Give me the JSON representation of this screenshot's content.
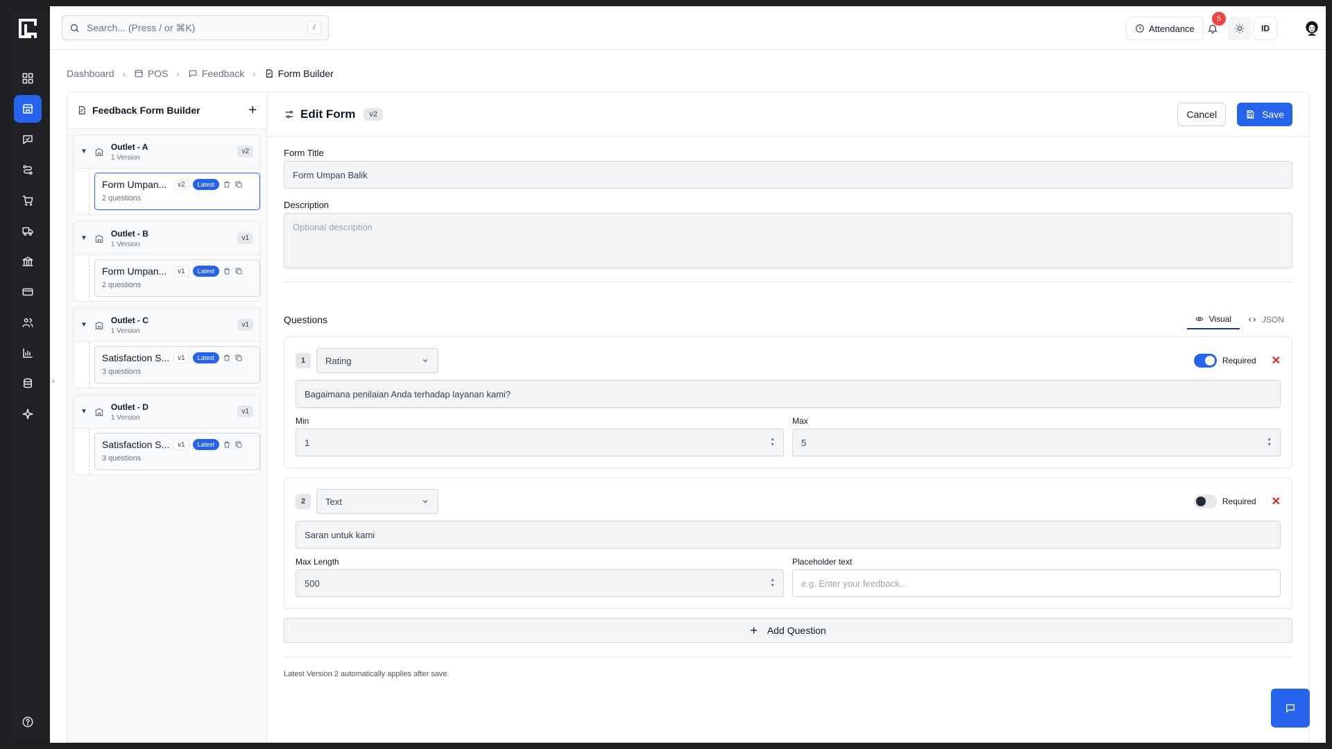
{
  "search": {
    "placeholder": "Search... (Press / or ⌘K)",
    "shortcut": "/"
  },
  "topbar": {
    "attendance_label": "Attendance",
    "notification_count": "5",
    "language": "ID"
  },
  "rail": {
    "items": [
      "dashboard-icon",
      "store-icon",
      "feedback-icon",
      "route-icon",
      "cart-icon",
      "delivery-icon",
      "bank-icon",
      "card-icon",
      "users-icon",
      "chart-icon",
      "database-icon",
      "sparkle-icon",
      "help-icon"
    ],
    "active_index": 1,
    "accent": "#2563eb"
  },
  "breadcrumb": {
    "items": [
      "Dashboard",
      "POS",
      "Feedback",
      "Form Builder"
    ]
  },
  "builder": {
    "title": "Feedback Form Builder",
    "groups": [
      {
        "name": "Outlet - A",
        "sub": "1 Version",
        "version": "v2",
        "card": {
          "name": "Form Umpan...",
          "tag": "v2",
          "latest": "Latest",
          "questions": "2 questions",
          "active": true
        }
      },
      {
        "name": "Outlet - B",
        "sub": "1 Version",
        "version": "v1",
        "card": {
          "name": "Form Umpan...",
          "tag": "v1",
          "latest": "Latest",
          "questions": "2 questions",
          "active": false
        }
      },
      {
        "name": "Outlet - C",
        "sub": "1 Version",
        "version": "v1",
        "card": {
          "name": "Satisfaction S...",
          "tag": "v1",
          "latest": "Latest",
          "questions": "3 questions",
          "active": false
        }
      },
      {
        "name": "Outlet - D",
        "sub": "1 Version",
        "version": "v1",
        "card": {
          "name": "Satisfaction S...",
          "tag": "v1",
          "latest": "Latest",
          "questions": "3 questions",
          "active": false
        }
      }
    ]
  },
  "editor": {
    "title": "Edit Form",
    "version": "v2",
    "cancel_label": "Cancel",
    "save_label": "Save",
    "form_title_label": "Form Title",
    "form_title_value": "Form Umpan Balik",
    "description_label": "Description",
    "description_placeholder": "Optional description",
    "questions_label": "Questions",
    "tabs": [
      "Visual",
      "JSON"
    ],
    "active_tab": "Visual",
    "questions": [
      {
        "number": "1",
        "type": "Rating",
        "required_label": "Required",
        "required": true,
        "text": "Bagaimana penilaian Anda terhadap layanan kami?",
        "field_a_label": "Min",
        "field_a_value": "1",
        "field_b_label": "Max",
        "field_b_value": "5"
      },
      {
        "number": "2",
        "type": "Text",
        "required_label": "Required",
        "required": false,
        "text": "Saran untuk kami",
        "field_a_label": "Max Length",
        "field_a_value": "500",
        "field_b_label": "Placeholder text",
        "field_b_placeholder": "e.g. Enter your feedback..."
      }
    ],
    "add_question_label": "Add Question",
    "footnote": "Latest Version 2 automatically applies after save."
  }
}
